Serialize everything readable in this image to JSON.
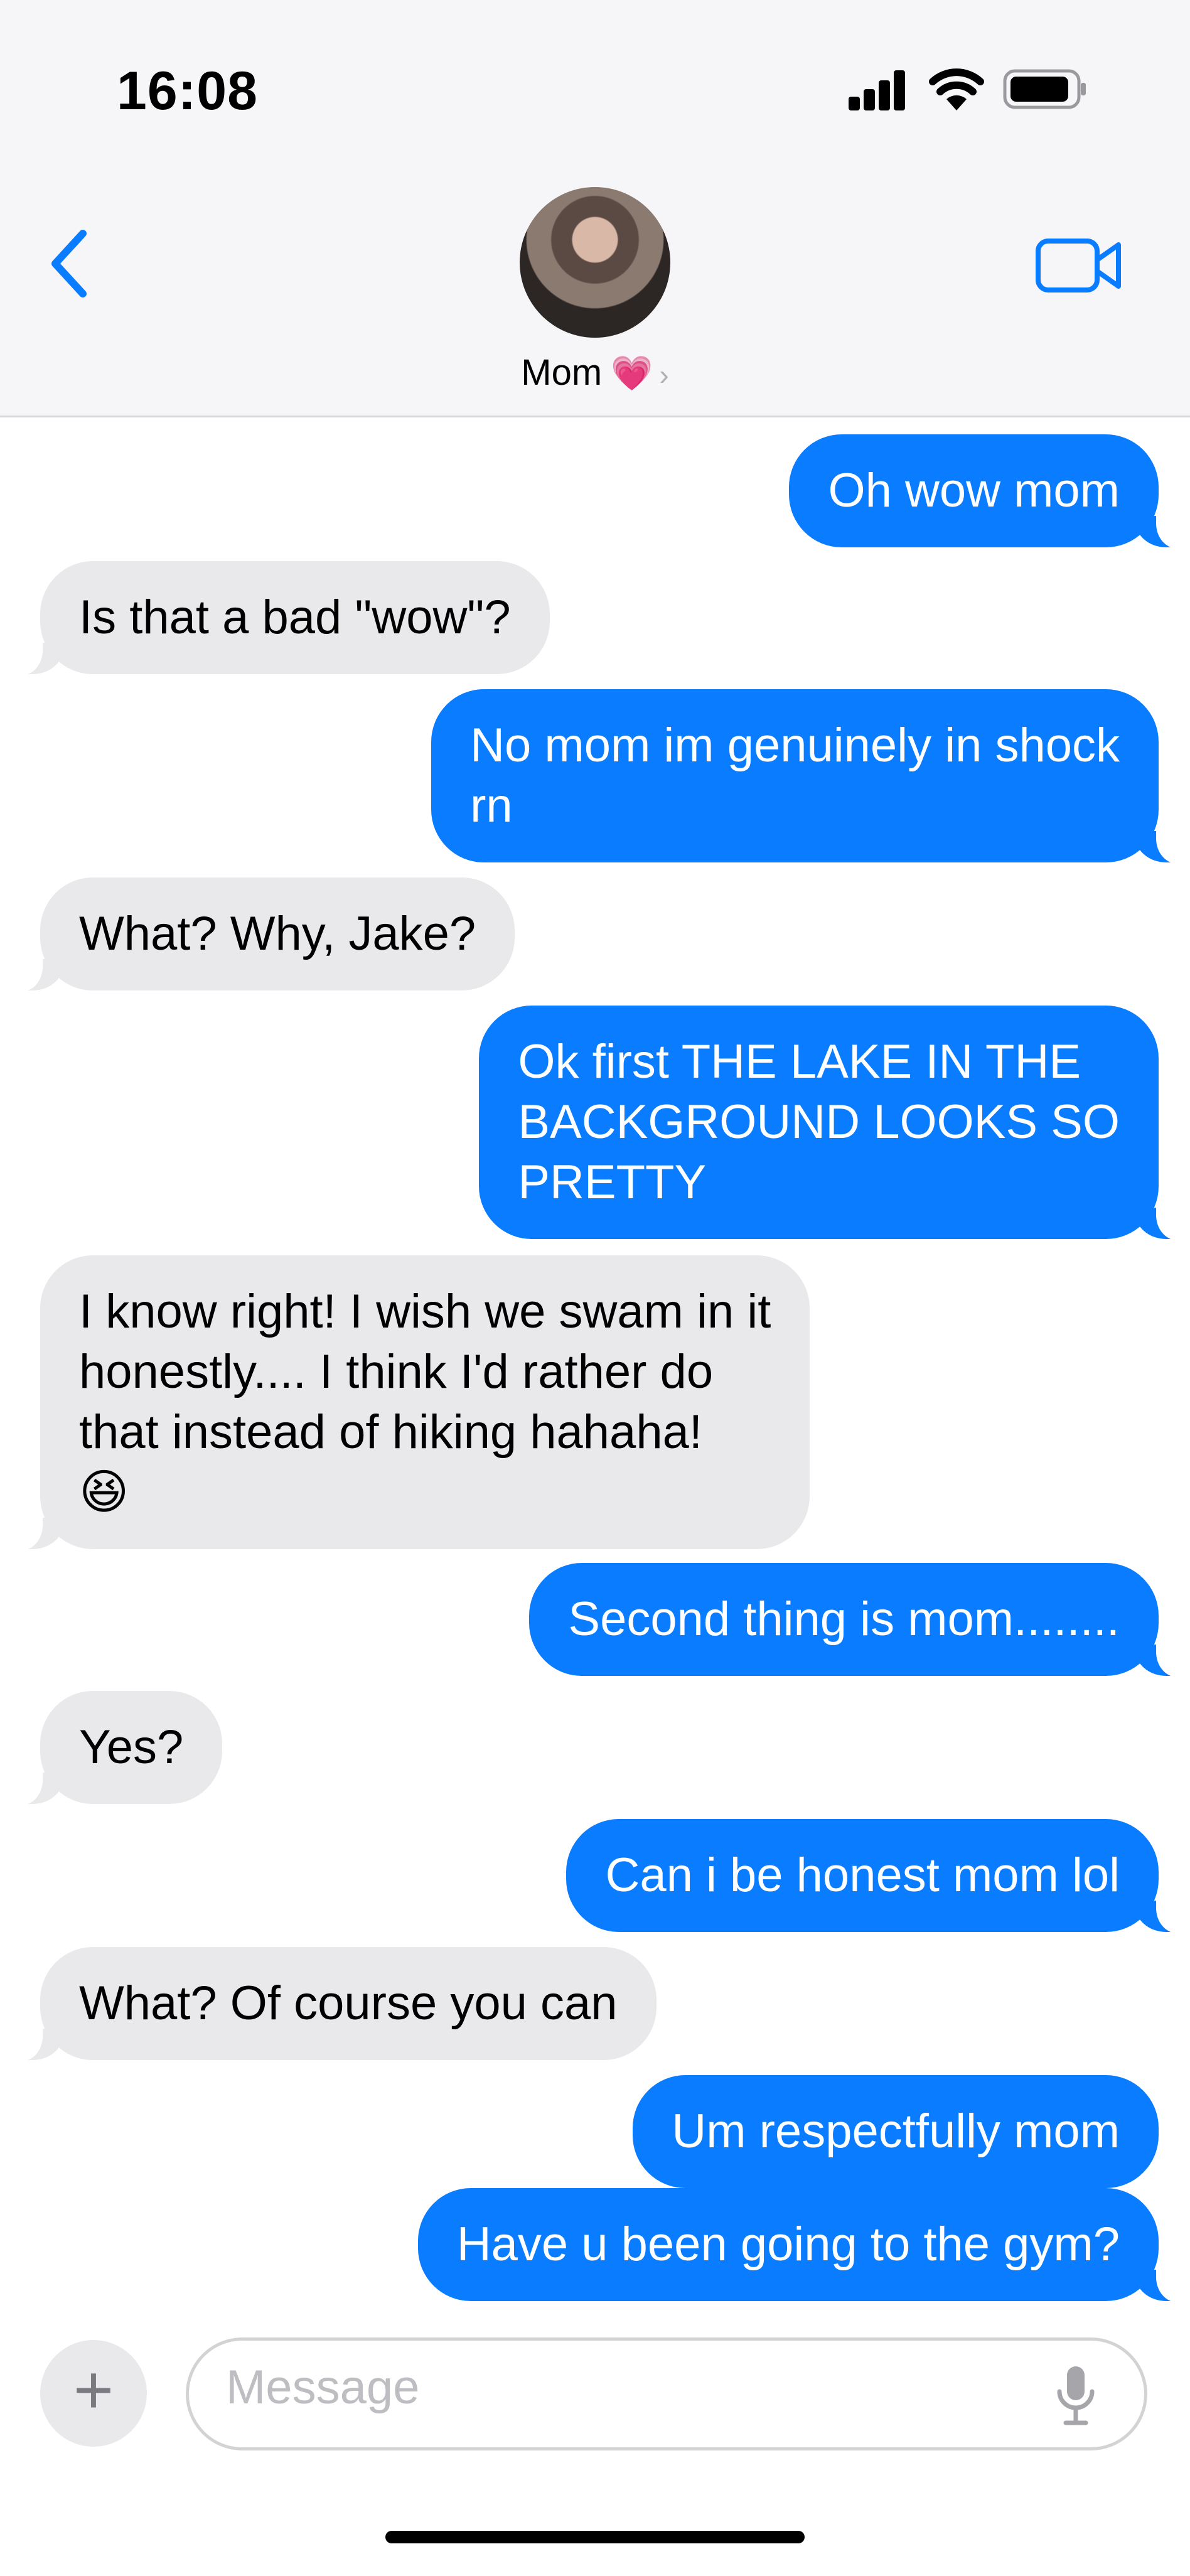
{
  "status_bar": {
    "time": "16:08"
  },
  "header": {
    "contact_name": "Mom",
    "contact_emoji": "💗",
    "chevron": "›",
    "back_icon": "chevron-left-icon",
    "video_icon": "video-camera-icon"
  },
  "messages": [
    {
      "sender": "me",
      "text": "Oh wow mom"
    },
    {
      "sender": "mom",
      "text": "Is that a bad \"wow\"?"
    },
    {
      "sender": "me",
      "text": "No mom im genuinely in shock\nrn"
    },
    {
      "sender": "mom",
      "text": "What? Why, Jake?"
    },
    {
      "sender": "me",
      "text": "Ok first THE LAKE IN THE\nBACKGROUND LOOKS SO\nPRETTY"
    },
    {
      "sender": "mom",
      "text": "I know right! I wish we swam in it\nhonestly.... I think I'd rather do\nthat instead of hiking hahaha!\n😆"
    },
    {
      "sender": "me",
      "text": "Second thing is mom........"
    },
    {
      "sender": "mom",
      "text": "Yes?"
    },
    {
      "sender": "me",
      "text": "Can i be honest mom lol"
    },
    {
      "sender": "mom",
      "text": "What? Of course you can"
    },
    {
      "sender": "me",
      "text": "Um respectfully mom"
    },
    {
      "sender": "me",
      "text": "Have u been going to the gym?"
    }
  ],
  "compose": {
    "placeholder": "Message",
    "plus_label": "+",
    "mic_icon": "microphone-icon"
  },
  "colors": {
    "outgoing_bubble": "#0a7cff",
    "incoming_bubble": "#e9e9eb",
    "accent": "#0a7cff"
  }
}
